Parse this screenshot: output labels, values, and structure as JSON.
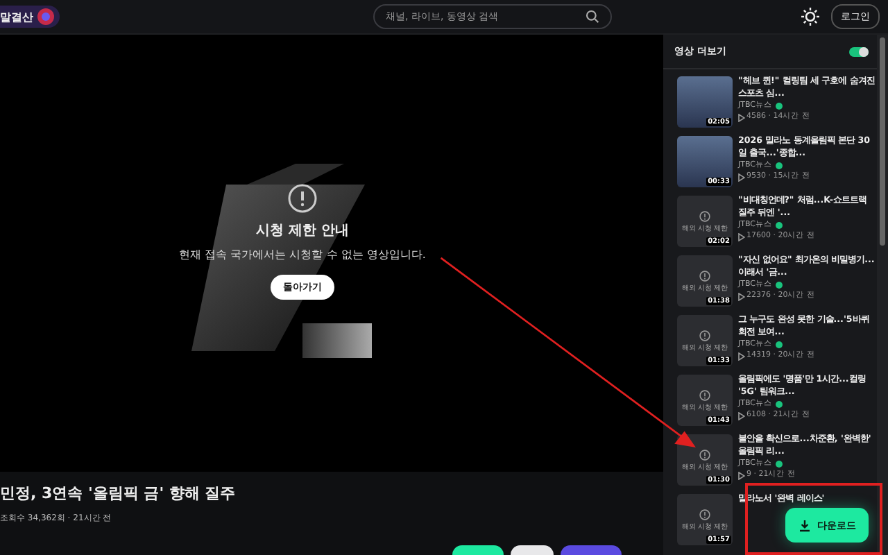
{
  "header": {
    "logo_text": "말결산",
    "search": {
      "placeholder": "채널, 라이브, 동영상 검색"
    },
    "login_button": "로그인"
  },
  "player": {
    "notice_title": "시청 제한 안내",
    "notice_text": "현재 접속 국가에서는 시청할 수 없는 영상입니다.",
    "back_button": "돌아가기"
  },
  "video": {
    "title": "민정, 3연속 '올림픽 금' 향해 질주",
    "meta": "조회수 34,362회 · 21시간 전"
  },
  "sidebar": {
    "heading": "영상 더보기",
    "autoplay_on": true,
    "items": [
      {
        "kind": "photo",
        "title": "\"헤브 퀸!\" 컬링팀 세 구호에 숨겨진 스포츠 심...",
        "channel": "JTBC뉴스",
        "verified": true,
        "stats": "4586 · 14시간 전",
        "duration": "02:05"
      },
      {
        "kind": "photo",
        "title": "2026 밀라노 동계올림픽 본단 30일 출국...'종합...",
        "channel": "JTBC뉴스",
        "verified": true,
        "stats": "9530 · 15시간 전",
        "duration": "00:33"
      },
      {
        "kind": "restricted",
        "thumb_label": "해외 시청 제한",
        "title": "\"비대칭언데?\" 처럼...K-쇼트트랙 질주 뒤엔 '...",
        "channel": "JTBC뉴스",
        "verified": true,
        "stats": "17600 · 20시간 전",
        "duration": "02:02"
      },
      {
        "kind": "restricted",
        "thumb_label": "해외 시청 제한",
        "title": "\"자신 없어요\" 최가온의 비밀병기...이래서 '금...",
        "channel": "JTBC뉴스",
        "verified": true,
        "stats": "22376 · 20시간 전",
        "duration": "01:38"
      },
      {
        "kind": "restricted",
        "thumb_label": "해외 시청 제한",
        "title": "그 누구도 완성 못한 기술...'5바퀴 회전 보여...",
        "channel": "JTBC뉴스",
        "verified": true,
        "stats": "14319 · 20시간 전",
        "duration": "01:33"
      },
      {
        "kind": "restricted",
        "thumb_label": "해외 시청 제한",
        "title": "올림픽에도 '명품'만 1시간...컬링 '5G' 팀워크...",
        "channel": "JTBC뉴스",
        "verified": true,
        "stats": "6108 · 21시간 전",
        "duration": "01:43"
      },
      {
        "kind": "restricted",
        "thumb_label": "해외 시청 제한",
        "title": "불안을 확신으로...차준환, '완벽한' 올림픽 리...",
        "channel": "JTBC뉴스",
        "verified": true,
        "stats": "9 · 21시간 전",
        "duration": "01:30"
      },
      {
        "kind": "restricted",
        "thumb_label": "해외 시청 제한",
        "title": "밀라노서 '완벽 레이스'",
        "duration": "01:57"
      }
    ]
  },
  "download_button": "다운로드"
}
